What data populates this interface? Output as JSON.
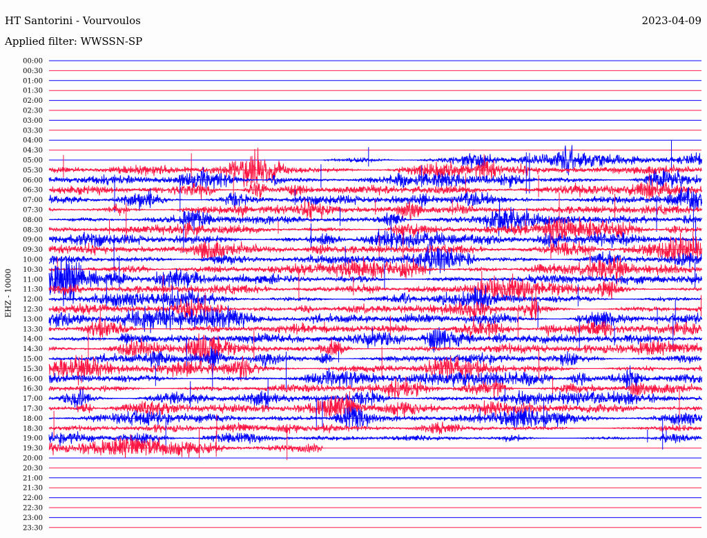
{
  "header": {
    "station": "HT Santorini - Vourvoulos",
    "date": "2023-04-09",
    "filter": "Applied filter: WWSSN-SP"
  },
  "colors": {
    "trace_a": "#0000ff",
    "trace_b": "#ff1744",
    "background": "#fdfdfd"
  },
  "chart_data": {
    "type": "line",
    "title": "HT Santorini - Vourvoulos",
    "ylabel": "EHZ - 10000",
    "row_labels": [
      "00:00",
      "00:30",
      "01:00",
      "01:30",
      "02:00",
      "02:30",
      "03:00",
      "03:30",
      "04:00",
      "04:30",
      "05:00",
      "05:30",
      "06:00",
      "06:30",
      "07:00",
      "07:30",
      "08:00",
      "08:30",
      "09:00",
      "09:30",
      "10:00",
      "10:30",
      "11:00",
      "11:30",
      "12:00",
      "12:30",
      "13:00",
      "13:30",
      "14:00",
      "14:30",
      "15:00",
      "15:30",
      "16:00",
      "16:30",
      "17:00",
      "17:30",
      "18:00",
      "18:30",
      "19:00",
      "19:30",
      "20:00",
      "20:30",
      "21:00",
      "21:30",
      "22:00",
      "22:30",
      "23:00",
      "23:30"
    ],
    "row_colors": [
      "blue",
      "red"
    ],
    "data_start_row": "05:00",
    "data_start_fraction": 0.42,
    "data_end_row": "19:30",
    "data_end_fraction": 0.42,
    "grid": true,
    "legend": "none"
  }
}
